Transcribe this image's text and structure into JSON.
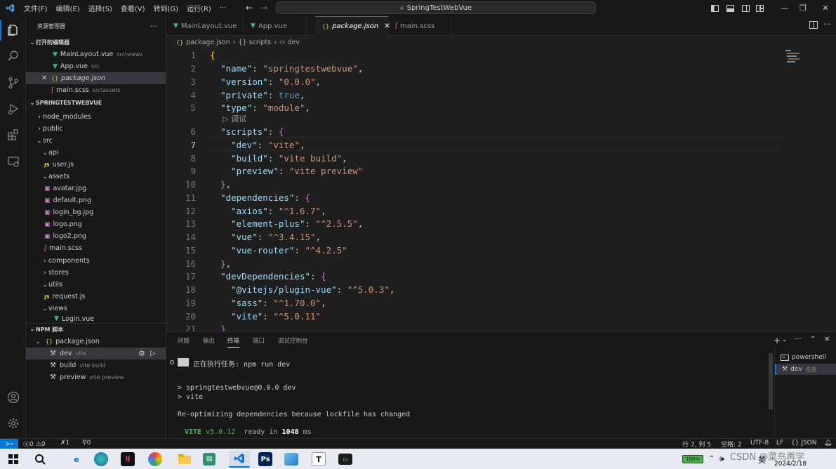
{
  "titlebar": {
    "menu": [
      "文件(F)",
      "编辑(E)",
      "选择(S)",
      "查看(V)",
      "转到(G)",
      "运行(R)",
      "···"
    ],
    "search": "SpringTestWebVue"
  },
  "sidebar": {
    "title": "资源管理器",
    "open_editors_header": "打开的编辑器",
    "open_editors": [
      {
        "name": "MainLayout.vue",
        "desc": "src\\views"
      },
      {
        "name": "App.vue",
        "desc": "src"
      },
      {
        "name": "package.json",
        "desc": ""
      },
      {
        "name": "main.scss",
        "desc": "src\\assets"
      }
    ],
    "project_header": "SPRINGTESTWEBVUE",
    "tree": [
      "node_modules",
      "public",
      "src",
      "api",
      "user.js",
      "assets",
      "avatar.jpg",
      "default.png",
      "login_bg.jpg",
      "logo.png",
      "logo2.png",
      "main.scss",
      "components",
      "stores",
      "utils",
      "request.js",
      "views",
      "Login.vue"
    ],
    "npm_header": "NPM 脚本",
    "npm_file": "package.json",
    "npm_scripts": [
      {
        "name": "dev",
        "cmd": "vite"
      },
      {
        "name": "build",
        "cmd": "vite build"
      },
      {
        "name": "preview",
        "cmd": "vite preview"
      }
    ]
  },
  "tabs": [
    "MainLayout.vue",
    "App.vue",
    "package.json",
    "main.scss"
  ],
  "breadcrumb": [
    "package.json",
    "{} scripts",
    "dev"
  ],
  "editor": {
    "line_numbers": [
      "1",
      "2",
      "3",
      "4",
      "5",
      "6",
      "7",
      "8",
      "9",
      "10",
      "11",
      "12",
      "13",
      "14",
      "15",
      "16",
      "17",
      "18",
      "19",
      "20",
      "21"
    ],
    "codelens": "调试",
    "lines": [
      "{",
      "  \"name\": \"springtestwebvue\",",
      "  \"version\": \"0.0.0\",",
      "  \"private\": true,",
      "  \"type\": \"module\",",
      "  \"scripts\": {",
      "    \"dev\": \"vite\",",
      "    \"build\": \"vite build\",",
      "    \"preview\": \"vite preview\"",
      "  },",
      "  \"dependencies\": {",
      "    \"axios\": \"^1.6.7\",",
      "    \"element-plus\": \"^2.5.5\",",
      "    \"vue\": \"^3.4.15\",",
      "    \"vue-router\": \"^4.2.5\"",
      "  },",
      "  \"devDependencies\": {",
      "    \"@vitejs/plugin-vue\": \"^5.0.3\",",
      "    \"sass\": \"^1.70.0\",",
      "    \"vite\": \"^5.0.11\"",
      "  }"
    ]
  },
  "panel": {
    "tabs": [
      "问题",
      "输出",
      "终端",
      "端口",
      "调试控制台"
    ],
    "terminal": {
      "task_line": "正在执行任务: npm run dev",
      "line1": "> springtestwebvue@0.0.0 dev",
      "line2": "> vite",
      "line3": "Re-optimizing dependencies because lockfile has changed",
      "vite_label": "VITE",
      "vite_version": "v5.0.12",
      "ready_text": "ready in",
      "ready_ms": "1048",
      "ms_unit": "ms"
    },
    "terminal_list": [
      {
        "name": "powershell",
        "desc": ""
      },
      {
        "name": "dev",
        "desc": "任务"
      }
    ]
  },
  "statusbar": {
    "errors": "0",
    "warnings": "0",
    "ports": "1",
    "workers": "0",
    "position": "行 7, 列 5",
    "spaces": "空格: 2",
    "encoding": "UTF-8",
    "eol": "LF",
    "language": "{} JSON"
  },
  "taskbar": {
    "battery": "100%",
    "ime": "英",
    "watermark": "CSDN @菜鸟再学",
    "date": "2024/2/18"
  },
  "colors": {
    "accent": "#0078d4",
    "key": "#9cdcfe",
    "string": "#ce9178",
    "bool": "#569cd6"
  }
}
